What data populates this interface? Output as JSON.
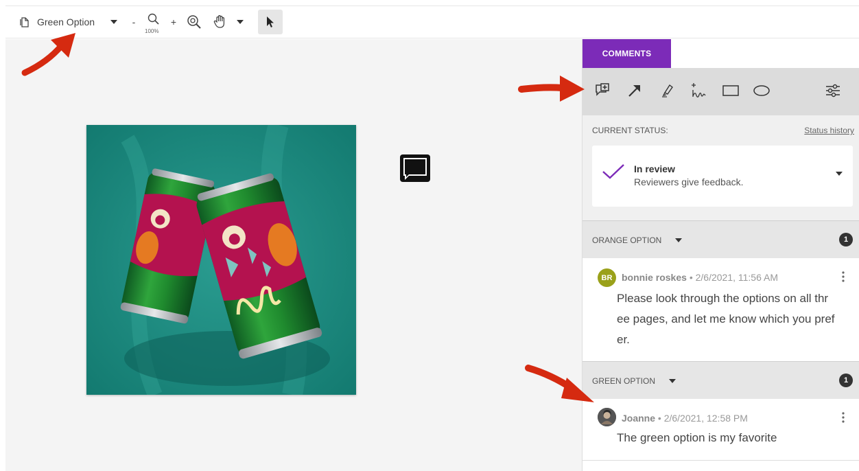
{
  "toolbar": {
    "page_name": "Green Option",
    "zoom_out": "-",
    "zoom_in": "+",
    "zoom_level": "100%"
  },
  "panel": {
    "tab_label": "COMMENTS",
    "status_heading": "CURRENT STATUS:",
    "status_history_link": "Status history",
    "status_title": "In review",
    "status_description": "Reviewers give feedback."
  },
  "groups": [
    {
      "title": "ORANGE OPTION",
      "count": "1",
      "comment": {
        "avatar_initials": "BR",
        "author": "bonnie roskes",
        "separator": "•",
        "timestamp": "2/6/2021, 11:56 AM",
        "lines": [
          "Please look through the options on all thr",
          "ee pages, and let me know which you pref",
          "er."
        ]
      }
    },
    {
      "title": "GREEN OPTION",
      "count": "1",
      "comment": {
        "author": "Joanne",
        "separator": "•",
        "timestamp": "2/6/2021, 12:58 PM",
        "lines": [
          "The green option is my favorite"
        ]
      }
    }
  ],
  "colors": {
    "accent": "#7c2bb8",
    "artwork_bg": "#1c8b81",
    "arrow": "#d52a10",
    "avatar_br": "#9aa11a"
  }
}
